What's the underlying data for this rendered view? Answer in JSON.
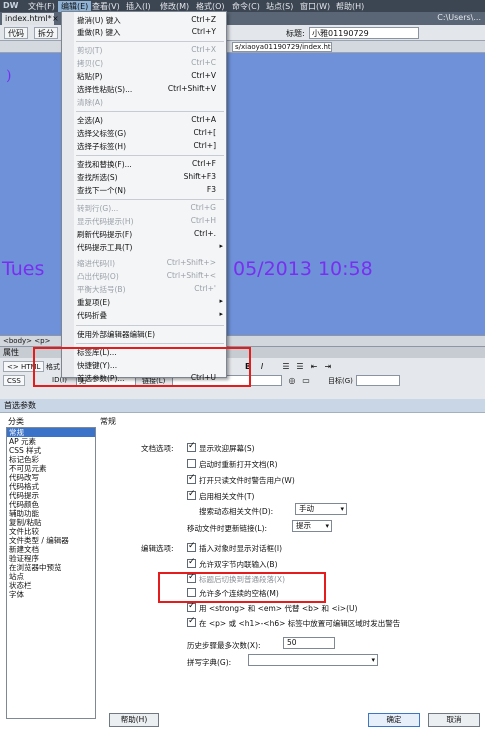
{
  "app": {
    "logo": "DW",
    "menus": [
      "文件(F)",
      "编辑(E)",
      "查看(V)",
      "插入(I)",
      "修改(M)",
      "格式(O)",
      "命令(C)",
      "站点(S)",
      "窗口(W)",
      "帮助(H)"
    ],
    "path_hint": "C:\\Users\\..."
  },
  "document": {
    "tab_label": "index.html*",
    "tab_close": "×",
    "path": "C:\\Users\\..."
  },
  "toolbar": {
    "code_label": "代码",
    "split_label": "拆分",
    "title_label": "标题:",
    "title_value": "小雅01190729"
  },
  "address": {
    "value": "s/xiaoya01190729/index.htm"
  },
  "canvas": {
    "ring_text": ")",
    "date_left": "Tues",
    "date_right": "05/2013 10:58"
  },
  "statusbar": {
    "tag_path": "<body> <p>"
  },
  "properties": {
    "title": "属性",
    "html_tab": "<> HTML",
    "css_tab": "CSS",
    "format_label": "格式",
    "format_bold": "B",
    "format_italic": "I",
    "id_label": "ID(I)",
    "id_value": "无",
    "link_label": "链接(L)",
    "target_label": "目标(G)"
  },
  "edit_menu": {
    "items": [
      {
        "label": "撤消(U) 键入",
        "shortcut": "Ctrl+Z",
        "disabled": false
      },
      {
        "label": "重做(R) 键入",
        "shortcut": "Ctrl+Y",
        "disabled": false
      },
      {
        "label": "剪切(T)",
        "shortcut": "Ctrl+X",
        "disabled": true
      },
      {
        "label": "拷贝(C)",
        "shortcut": "Ctrl+C",
        "disabled": true
      },
      {
        "label": "粘贴(P)",
        "shortcut": "Ctrl+V",
        "disabled": false
      },
      {
        "label": "选择性粘贴(S)...",
        "shortcut": "Ctrl+Shift+V",
        "disabled": false
      },
      {
        "label": "清除(A)",
        "shortcut": "",
        "disabled": true
      },
      {
        "label": "全选(A)",
        "shortcut": "Ctrl+A",
        "disabled": false
      },
      {
        "label": "选择父标签(G)",
        "shortcut": "Ctrl+[",
        "disabled": false
      },
      {
        "label": "选择子标签(H)",
        "shortcut": "Ctrl+]",
        "disabled": false
      },
      {
        "label": "查找和替换(F)...",
        "shortcut": "Ctrl+F",
        "disabled": false
      },
      {
        "label": "查找所选(S)",
        "shortcut": "Shift+F3",
        "disabled": false
      },
      {
        "label": "查找下一个(N)",
        "shortcut": "F3",
        "disabled": false
      },
      {
        "label": "转到行(G)...",
        "shortcut": "Ctrl+G",
        "disabled": true
      },
      {
        "label": "显示代码提示(H)",
        "shortcut": "Ctrl+H",
        "disabled": true
      },
      {
        "label": "刷新代码提示(F)",
        "shortcut": "Ctrl+.",
        "disabled": false
      },
      {
        "label": "代码提示工具(T)",
        "shortcut": "",
        "disabled": false,
        "submenu": true
      },
      {
        "label": "缩进代码(I)",
        "shortcut": "Ctrl+Shift+>",
        "disabled": true
      },
      {
        "label": "凸出代码(O)",
        "shortcut": "Ctrl+Shift+<",
        "disabled": true
      },
      {
        "label": "平衡大括号(B)",
        "shortcut": "Ctrl+'",
        "disabled": true
      },
      {
        "label": "重复项(E)",
        "shortcut": "",
        "disabled": false,
        "submenu": true
      },
      {
        "label": "代码折叠",
        "shortcut": "",
        "disabled": false,
        "submenu": true
      },
      {
        "label": "使用外部编辑器编辑(E)",
        "shortcut": "",
        "disabled": false
      },
      {
        "label": "标签库(L)...",
        "shortcut": "",
        "disabled": false
      },
      {
        "label": "快捷键(Y)...",
        "shortcut": "",
        "disabled": false
      },
      {
        "label": "首选参数(P)...",
        "shortcut": "Ctrl+U",
        "disabled": false
      }
    ],
    "submenu_arrow": "▸"
  },
  "preferences": {
    "dialog_title": "首选参数",
    "category_header": "分类",
    "section_title": "常规",
    "categories": [
      "常规",
      "AP 元素",
      "CSS 样式",
      "标记色彩",
      "不可见元素",
      "代码改写",
      "代码格式",
      "代码提示",
      "代码颜色",
      "辅助功能",
      "复制/粘贴",
      "文件比较",
      "文件类型 / 编辑器",
      "新建文档",
      "验证程序",
      "在浏览器中预览",
      "站点",
      "状态栏",
      "字体"
    ],
    "selected_category": 0,
    "doc_options_label": "文档选项:",
    "doc_options": [
      {
        "label": "显示欢迎屏幕(S)",
        "checked": true
      },
      {
        "label": "启动时重新打开文档(R)",
        "checked": false
      },
      {
        "label": "打开只读文件时警告用户(W)",
        "checked": true
      },
      {
        "label": "启用相关文件(T)",
        "checked": true
      }
    ],
    "search_related_label": "搜索动态相关文件(D):",
    "search_related_value": "手动",
    "move_update_label": "移动文件时更新链接(L):",
    "move_update_value": "提示",
    "edit_options_label": "编辑选项:",
    "edit_options": [
      {
        "label": "插入对象时显示对话框(I)",
        "checked": true,
        "dim": false
      },
      {
        "label": "允许双字节内联输入(B)",
        "checked": true,
        "dim": false
      },
      {
        "label": "标题后切换到普通段落(X)",
        "checked": true,
        "dim": true
      },
      {
        "label": "允许多个连续的空格(M)",
        "checked": false,
        "dim": false
      },
      {
        "label": "用 <strong> 和 <em> 代替 <b> 和 <i>(U)",
        "checked": true,
        "dim": false
      },
      {
        "label": "在 <p> 或 <h1>-<h6> 标签中放置可编辑区域时发出警告",
        "checked": true,
        "dim": false
      }
    ],
    "history_label": "历史步骤最多次数(X):",
    "history_value": "50",
    "spell_label": "拼写字典(G):",
    "spell_value": "",
    "help_button": "帮助(H)",
    "ok_button": "确定",
    "cancel_button": "取消",
    "dropdown_arrow": "▾"
  },
  "colors": {
    "highlight_box": "#e41c1c",
    "selected_category_bg": "#3a73c8",
    "canvas_bg": "#6e91d9",
    "canvas_text": "#7a2ff0"
  }
}
